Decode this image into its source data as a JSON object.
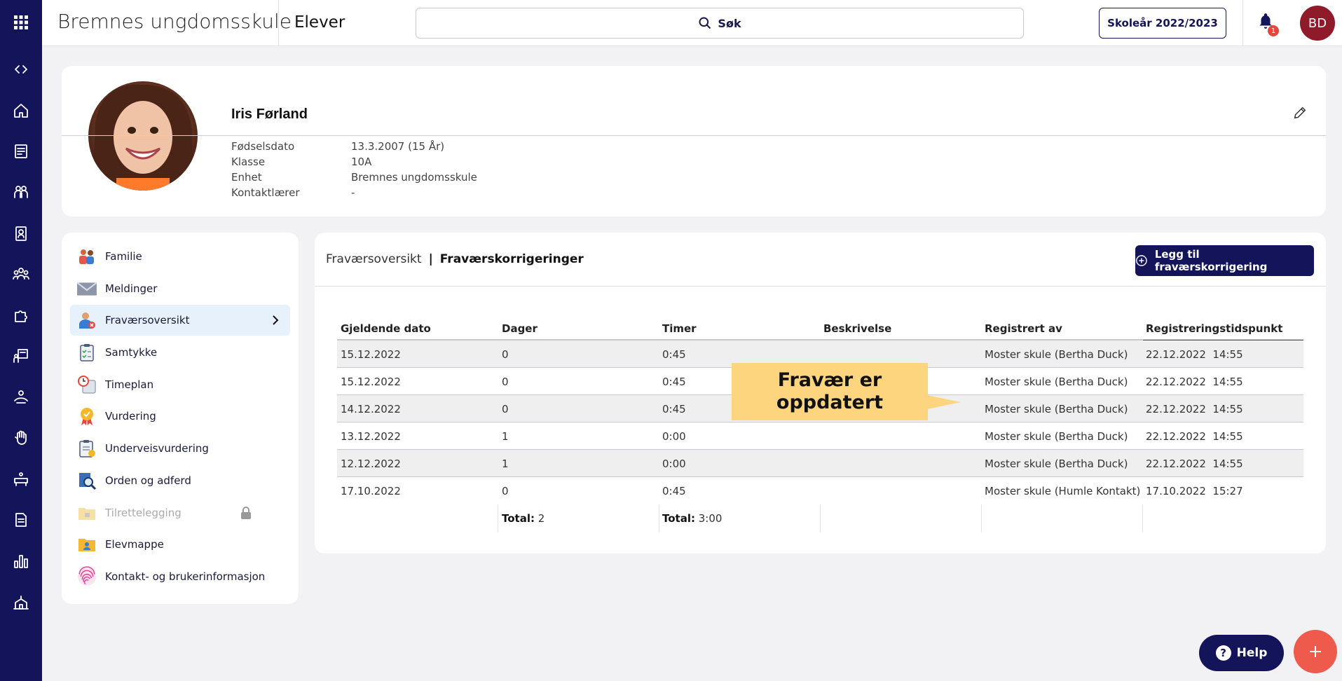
{
  "header": {
    "school_name": "Bremnes ungdomsskule",
    "section_title": "Elever",
    "search_label": "Søk",
    "school_year_button": "Skoleår 2022/2023",
    "notification_count": "1",
    "user_initials": "BD"
  },
  "rail": {
    "icons": [
      "apps-grid-icon",
      "collapse-toggle-icon",
      "home-icon",
      "news-icon",
      "people-icon",
      "badge-icon",
      "group-icon",
      "puzzle-icon",
      "classroom-icon",
      "user-hand-icon",
      "hand-icon",
      "desk-icon",
      "document-icon",
      "chart-icon",
      "school-icon"
    ]
  },
  "profile": {
    "name": "Iris Førland",
    "facts": [
      {
        "label": "Fødselsdato",
        "value": "13.3.2007 (15 År)"
      },
      {
        "label": "Klasse",
        "value": "10A"
      },
      {
        "label": "Enhet",
        "value": "Bremnes ungdomsskule"
      },
      {
        "label": "Kontaktlærer",
        "value": "-"
      }
    ]
  },
  "menu": {
    "items": [
      {
        "label": "Familie",
        "icon": "family-icon"
      },
      {
        "label": "Meldinger",
        "icon": "envelope-icon"
      },
      {
        "label": "Fraværsoversikt",
        "icon": "absence-icon",
        "active": true
      },
      {
        "label": "Samtykke",
        "icon": "clipboard-check-icon"
      },
      {
        "label": "Timeplan",
        "icon": "calendar-clock-icon"
      },
      {
        "label": "Vurdering",
        "icon": "medal-icon"
      },
      {
        "label": "Underveisvurdering",
        "icon": "clipboard-note-icon"
      },
      {
        "label": "Orden og adferd",
        "icon": "magnifier-doc-icon"
      },
      {
        "label": "Tilrettelegging",
        "icon": "folder-lock-icon",
        "disabled": true
      },
      {
        "label": "Elevmappe",
        "icon": "folder-person-icon"
      },
      {
        "label": "Kontakt- og brukerinformasjon",
        "icon": "fingerprint-icon"
      }
    ]
  },
  "panel": {
    "breadcrumb_parent": "Fraværsoversikt",
    "breadcrumb_separator": "|",
    "breadcrumb_current": "Fraværskorrigeringer",
    "add_button": "Legg til fraværskorrigering",
    "columns": [
      "Gjeldende dato",
      "Dager",
      "Timer",
      "Beskrivelse",
      "Registrert av",
      "Registreringstidspunkt"
    ],
    "rows": [
      [
        "15.12.2022",
        "0",
        "0:45",
        "",
        "Moster skule (Bertha Duck)",
        "22.12.2022  14:55"
      ],
      [
        "15.12.2022",
        "0",
        "0:45",
        "",
        "Moster skule (Bertha Duck)",
        "22.12.2022  14:55"
      ],
      [
        "14.12.2022",
        "0",
        "0:45",
        "",
        "Moster skule (Bertha Duck)",
        "22.12.2022  14:55"
      ],
      [
        "13.12.2022",
        "1",
        "0:00",
        "",
        "Moster skule (Bertha Duck)",
        "22.12.2022  14:55"
      ],
      [
        "12.12.2022",
        "1",
        "0:00",
        "",
        "Moster skule (Bertha Duck)",
        "22.12.2022  14:55"
      ],
      [
        "17.10.2022",
        "0",
        "0:45",
        "",
        "Moster skule (Humle Kontakt)",
        "17.10.2022  15:27"
      ]
    ],
    "totals": {
      "label": "Total:",
      "days": "2",
      "hours": "3:00"
    }
  },
  "callout": {
    "line1": "Fravær er",
    "line2": "oppdatert"
  },
  "help_button": "Help",
  "colors": {
    "brand": "#14145a",
    "accent": "#ee5a4c",
    "callout": "#fdd57e",
    "active_item": "#e6f1fb"
  }
}
